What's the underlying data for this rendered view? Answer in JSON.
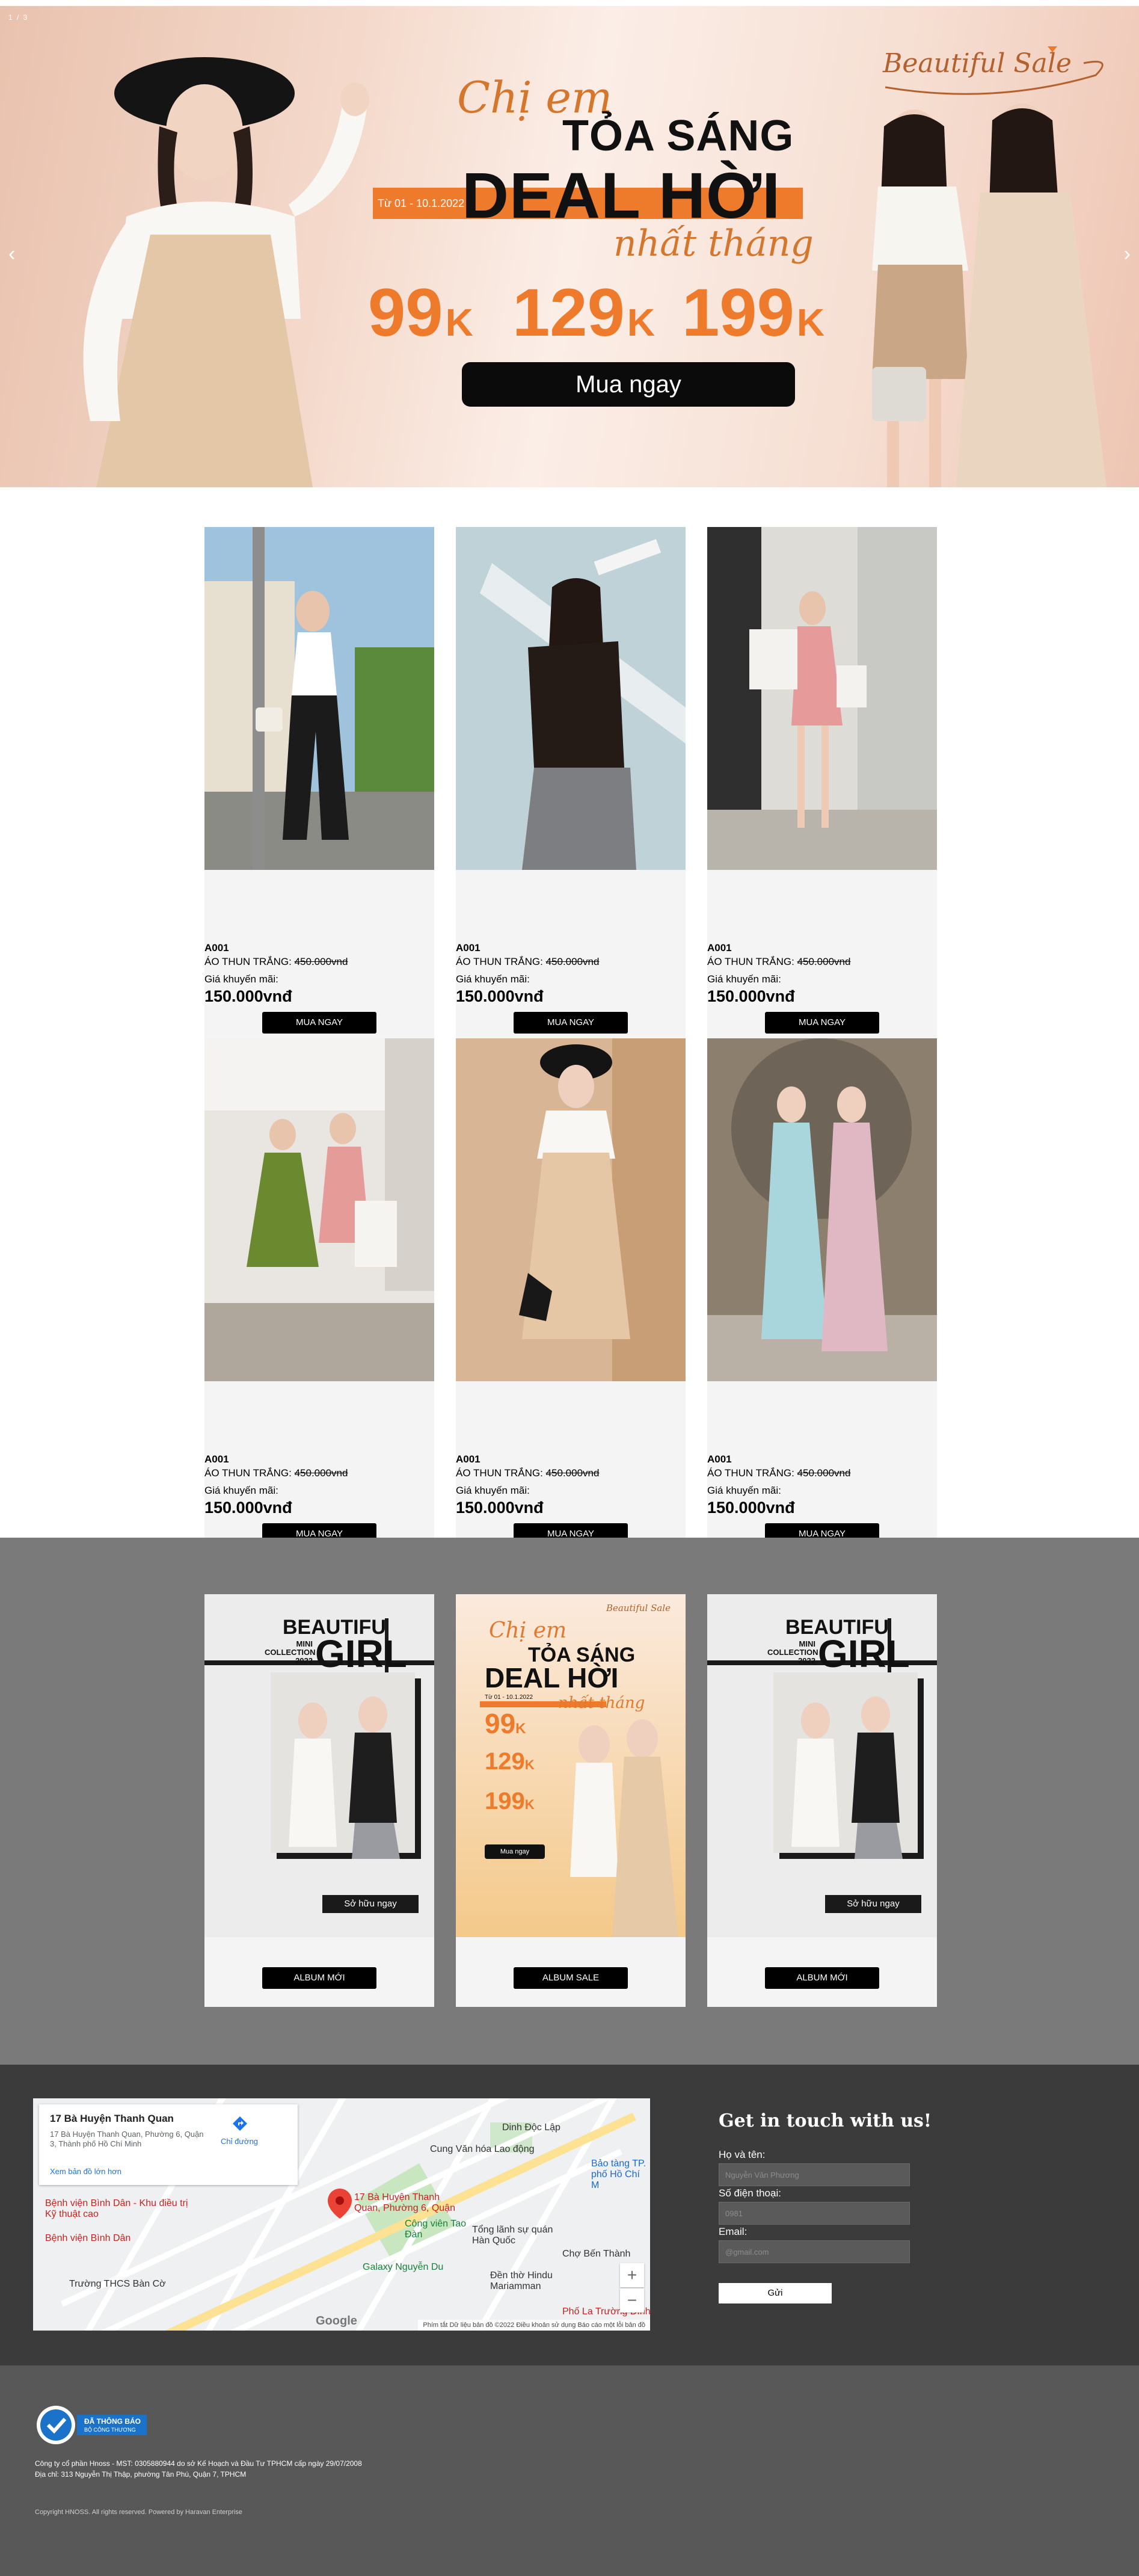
{
  "hero": {
    "counter": "1 / 3",
    "prev_arrow": "‹",
    "next_arrow": "›",
    "script_line1": "Chị em",
    "headline1": "TỎA SÁNG",
    "date_range": "Từ 01 - 10.1.2022",
    "headline2": "DEAL HỜI",
    "script_line2": "nhất tháng",
    "prices": [
      {
        "value": "99",
        "unit": "K"
      },
      {
        "value": "129",
        "unit": "K"
      },
      {
        "value": "199",
        "unit": "K"
      }
    ],
    "cta": "Mua ngay",
    "logo": "Beautiful Sale",
    "colors": {
      "accent": "#ee7a2c",
      "bg_light": "#fbeee7",
      "text_dark": "#111111"
    }
  },
  "products": {
    "items": [
      {
        "code": "A001",
        "name": "ÁO THUN TRẮNG:",
        "old_price": "450.000vnd",
        "promo_label": "Giá khuyến mãi:",
        "new_price": "150.000vnđ",
        "buy": "MUA NGAY"
      },
      {
        "code": "A001",
        "name": "ÁO THUN TRẮNG:",
        "old_price": "450.000vnd",
        "promo_label": "Giá khuyến mãi:",
        "new_price": "150.000vnđ",
        "buy": "MUA NGAY"
      },
      {
        "code": "A001",
        "name": "ÁO THUN TRẮNG:",
        "old_price": "450.000vnd",
        "promo_label": "Giá khuyến mãi:",
        "new_price": "150.000vnđ",
        "buy": "MUA NGAY"
      },
      {
        "code": "A001",
        "name": "ÁO THUN TRẮNG:",
        "old_price": "450.000vnd",
        "promo_label": "Giá khuyến mãi:",
        "new_price": "150.000vnđ",
        "buy": "MUA NGAY"
      },
      {
        "code": "A001",
        "name": "ÁO THUN TRẮNG:",
        "old_price": "450.000vnd",
        "promo_label": "Giá khuyến mãi:",
        "new_price": "150.000vnđ",
        "buy": "MUA NGAY"
      },
      {
        "code": "A001",
        "name": "ÁO THUN TRẮNG:",
        "old_price": "450.000vnd",
        "promo_label": "Giá khuyến mãi:",
        "new_price": "150.000vnđ",
        "buy": "MUA NGAY"
      }
    ]
  },
  "albums": {
    "items": [
      {
        "poster_title1": "BEAUTIFU",
        "poster_title2": "GIRL",
        "poster_sub1": "MINI",
        "poster_sub2": "COLLECTION",
        "poster_sub3": "2022",
        "poster_cta": "Sở hữu ngay",
        "button": "ALBUM MỚI"
      },
      {
        "poster_script": "Chị em",
        "poster_line1": "TỎA SÁNG",
        "poster_line2": "DEAL HỜI",
        "poster_date": "Từ 01 - 10.1.2022",
        "poster_script2": "nhất tháng",
        "poster_logo": "Beautiful Sale",
        "poster_prices": [
          "99",
          "129",
          "199"
        ],
        "poster_unit": "K",
        "poster_cta": "Mua ngay",
        "button": "ALBUM SALE"
      },
      {
        "poster_title1": "BEAUTIFU",
        "poster_title2": "GIRL",
        "poster_sub1": "MINI",
        "poster_sub2": "COLLECTION",
        "poster_sub3": "2022",
        "poster_cta": "Sở hữu ngay",
        "button": "ALBUM MỚI"
      }
    ]
  },
  "map": {
    "place_title": "17 Bà Huyện Thanh Quan",
    "place_address": "17 Bà Huyện Thanh Quan, Phường 6, Quận 3, Thành phố Hồ Chí Minh",
    "directions": "Chỉ đường",
    "view_larger": "Xem bản đồ lớn hơn",
    "pin_label": "17 Bà Huyện Thanh Quan, Phường 6, Quận",
    "labels": [
      {
        "text": "Dinh Độc Lập",
        "style": ""
      },
      {
        "text": "Cung Văn hóa Lao động",
        "style": ""
      },
      {
        "text": "Bảo tàng TP. phố Hồ Chí M",
        "style": "blue"
      },
      {
        "text": "Bệnh viện Bình Dân - Khu điều trị Kỹ thuật cao",
        "style": "red"
      },
      {
        "text": "Bệnh viện Bình Dân",
        "style": "red"
      },
      {
        "text": "Trường THCS Bàn Cờ",
        "style": ""
      },
      {
        "text": "Công viên Tao Đàn",
        "style": "green"
      },
      {
        "text": "Tổng lãnh sự quán Hàn Quốc",
        "style": ""
      },
      {
        "text": "Galaxy Nguyễn Du",
        "style": "green"
      },
      {
        "text": "Đền thờ Hindu Mariamman",
        "style": ""
      },
      {
        "text": "Chợ Bến Thành",
        "style": ""
      },
      {
        "text": "Phố La Trường Đình",
        "style": "red"
      }
    ],
    "zoom_in": "+",
    "zoom_out": "−",
    "google": "Google",
    "footer": "Phím tắt   Dữ liệu bản đồ ©2022   Điều khoản sử dụng   Báo cáo một lỗi bản đồ"
  },
  "contact": {
    "title": "Get in touch with us!",
    "name_label": "Họ và tên:",
    "name_placeholder": "Nguyễn Văn Phương",
    "phone_label": "Số điện thoại:",
    "phone_placeholder": "0981",
    "email_label": "Email:",
    "email_placeholder": "@gmail.com",
    "submit": "Gửi"
  },
  "footer": {
    "badge_line1": "ĐÃ THÔNG BÁO",
    "badge_line2": "BỘ CÔNG THƯƠNG",
    "company_line": "Công ty cổ phần Hnoss - MST: 0305880944 do sở Kế Hoạch và Đầu Tư TPHCM cấp ngày 29/07/2008",
    "address_line": "Địa chỉ: 313 Nguyễn Thị Thập, phường Tân Phú, Quận 7, TPHCM",
    "copyright": "Copyright HNOSS. All rights reserved. Powered by Haravan Enterprise"
  }
}
